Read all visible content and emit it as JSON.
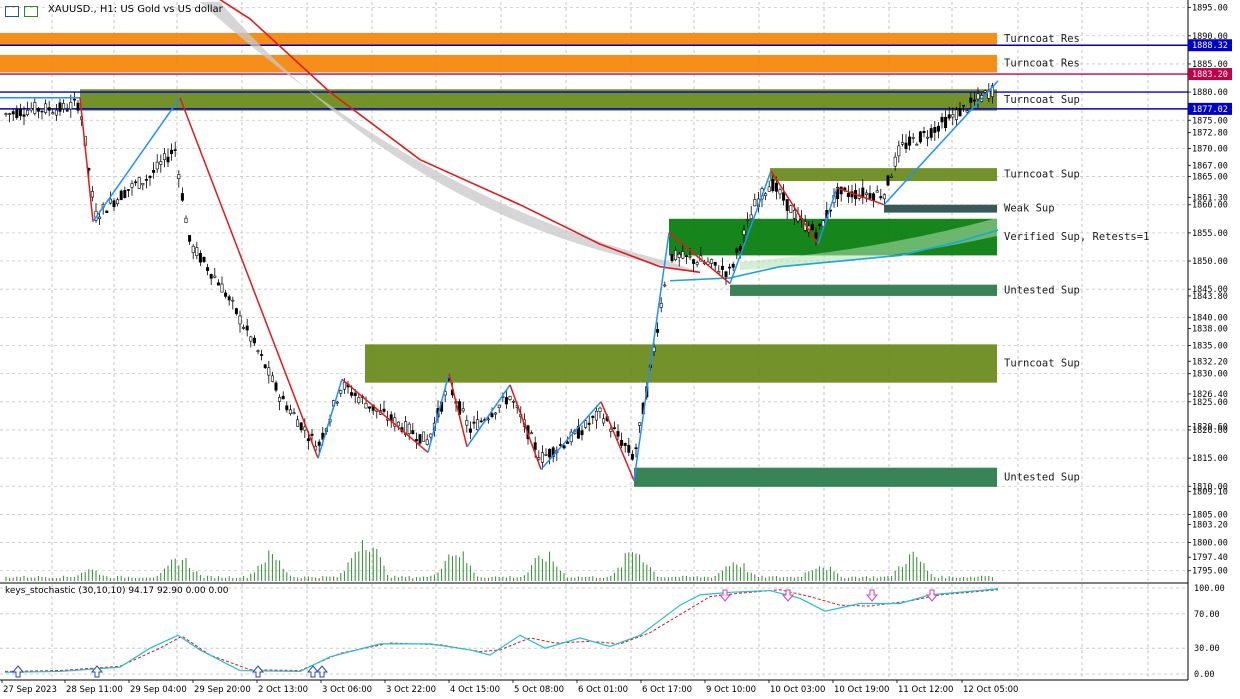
{
  "window": {
    "title": "XAUUSD., H1:  US Gold vs US dollar",
    "icons": [
      "chart-window-icon",
      "symbol-properties-icon"
    ]
  },
  "indicator": {
    "title": "keys_stochastic (30,10,10) 94.17 92.90 0.00 0.00",
    "levels": [
      "100.00",
      "70.00",
      "30.00",
      "0.00"
    ]
  },
  "colors": {
    "orange_zone": "#f4880e",
    "olive_zone": "#6b8c1e",
    "green_zone": "#0a7f10",
    "teal_zone": "#2e7d4d",
    "dark_zone": "#2f4f4f",
    "bear_line": "#e31a1a",
    "bull_line": "#1e90ff",
    "ma_cyan": "#19a9d6",
    "stoch_main": "#1fc1d6",
    "stoch_signal": "#d61a1a",
    "hline_blue": "#0000a0",
    "volume": "#2e8b2e"
  },
  "price_axis": {
    "labels": [
      "1895.00",
      "1890.00",
      "1885.00",
      "1880.00",
      "1875.00",
      "1872.80",
      "1870.00",
      "1867.00",
      "1865.00",
      "1861.30",
      "1860.00",
      "1855.00",
      "1850.00",
      "1845.00",
      "1843.80",
      "1840.00",
      "1838.00",
      "1835.00",
      "1832.20",
      "1830.00",
      "1826.40",
      "1825.00",
      "1820.60",
      "1820.00",
      "1815.00",
      "1810.00",
      "1809.10",
      "1805.00",
      "1803.20",
      "1800.00",
      "1797.40",
      "1795.00"
    ],
    "highlights": [
      {
        "label": "1888.32",
        "color": "#0000c8"
      },
      {
        "label": "1883.20",
        "color": "#c0004a"
      },
      {
        "label": "1877.02",
        "color": "#0000c8"
      }
    ]
  },
  "time_axis": {
    "labels": [
      "27 Sep 2023",
      "28 Sep 11:00",
      "29 Sep 04:00",
      "29 Sep 20:00",
      "2 Oct 13:00",
      "3 Oct 06:00",
      "3 Oct 22:00",
      "4 Oct 15:00",
      "5 Oct 08:00",
      "6 Oct 01:00",
      "6 Oct 17:00",
      "9 Oct 10:00",
      "10 Oct 03:00",
      "10 Oct 19:00",
      "11 Oct 12:00",
      "12 Oct 05:00"
    ]
  },
  "zones": [
    {
      "label": "Turncoat Res"
    },
    {
      "label": "Turncoat Res"
    },
    {
      "label": "Turncoat Sup"
    },
    {
      "label": "Turncoat Sup"
    },
    {
      "label": "Weak Sup"
    },
    {
      "label": "Verified Sup, Retests=1"
    },
    {
      "label": "Untested Sup"
    },
    {
      "label": "Turncoat Sup"
    },
    {
      "label": "Untested Sup"
    }
  ],
  "chart_data": {
    "type": "candlestick",
    "symbol": "XAUUSD.",
    "timeframe": "H1",
    "ylim": [
      1793,
      1896
    ],
    "x_labels": [
      "27 Sep 2023",
      "28 Sep 11:00",
      "29 Sep 04:00",
      "29 Sep 20:00",
      "2 Oct 13:00",
      "3 Oct 06:00",
      "3 Oct 22:00",
      "4 Oct 15:00",
      "5 Oct 08:00",
      "6 Oct 01:00",
      "6 Oct 17:00",
      "9 Oct 10:00",
      "10 Oct 03:00",
      "10 Oct 19:00",
      "11 Oct 12:00",
      "12 Oct 05:00"
    ],
    "zones": [
      {
        "label": "Turncoat Res",
        "type": "resistance",
        "low": 1888.3,
        "high": 1890.5,
        "color": "#f4880e"
      },
      {
        "label": "Turncoat Res",
        "type": "resistance",
        "low": 1883.5,
        "high": 1886.6,
        "color": "#f4880e"
      },
      {
        "label": "Turncoat Sup",
        "type": "support",
        "low": 1876.7,
        "high": 1880.5,
        "color": "#6b8c1e"
      },
      {
        "label": "Turncoat Sup",
        "type": "support",
        "low": 1864.2,
        "high": 1866.5,
        "color": "#6b8c1e"
      },
      {
        "label": "Weak Sup",
        "type": "support",
        "low": 1858.6,
        "high": 1860.0,
        "color": "#2f4f4f"
      },
      {
        "label": "Verified Sup, Retests=1",
        "type": "support",
        "low": 1851.0,
        "high": 1857.5,
        "color": "#0a7f10"
      },
      {
        "label": "Untested Sup",
        "type": "support",
        "low": 1843.8,
        "high": 1845.8,
        "color": "#2e7d4d"
      },
      {
        "label": "Turncoat Sup",
        "type": "support",
        "low": 1828.4,
        "high": 1835.2,
        "color": "#6b8c1e"
      },
      {
        "label": "Untested Sup",
        "type": "support",
        "low": 1809.9,
        "high": 1813.3,
        "color": "#2e7d4d"
      }
    ],
    "horizontal_lines": [
      {
        "price": 1888.32,
        "color": "#0000c8"
      },
      {
        "price": 1883.2,
        "color": "#c0004a"
      },
      {
        "price": 1880.0,
        "color": "#0000c8"
      },
      {
        "price": 1877.02,
        "color": "#0000c8"
      }
    ],
    "zigzag": [
      [
        0,
        1879
      ],
      [
        80,
        1879
      ],
      [
        93,
        1857
      ],
      [
        180,
        1879
      ],
      [
        318,
        1815
      ],
      [
        342,
        1829
      ],
      [
        428,
        1816
      ],
      [
        449,
        1830
      ],
      [
        467,
        1817
      ],
      [
        510,
        1828
      ],
      [
        541,
        1813
      ],
      [
        601,
        1825
      ],
      [
        634,
        1811
      ],
      [
        669,
        1855
      ],
      [
        730,
        1846
      ],
      [
        771,
        1866
      ],
      [
        818,
        1853
      ],
      [
        837,
        1863
      ],
      [
        884,
        1860
      ],
      [
        998,
        1882
      ]
    ],
    "ohlc_path": [
      [
        5,
        1876
      ],
      [
        30,
        1877
      ],
      [
        60,
        1877
      ],
      [
        80,
        1878
      ],
      [
        95,
        1858
      ],
      [
        130,
        1863
      ],
      [
        150,
        1865
      ],
      [
        175,
        1870
      ],
      [
        190,
        1853
      ],
      [
        220,
        1846
      ],
      [
        255,
        1835
      ],
      [
        280,
        1826
      ],
      [
        318,
        1817
      ],
      [
        342,
        1828
      ],
      [
        380,
        1823
      ],
      [
        428,
        1818
      ],
      [
        449,
        1828
      ],
      [
        470,
        1820
      ],
      [
        510,
        1826
      ],
      [
        541,
        1815
      ],
      [
        575,
        1819
      ],
      [
        601,
        1823
      ],
      [
        634,
        1815
      ],
      [
        650,
        1830
      ],
      [
        669,
        1851
      ],
      [
        700,
        1850
      ],
      [
        730,
        1848
      ],
      [
        755,
        1860
      ],
      [
        771,
        1864
      ],
      [
        800,
        1857
      ],
      [
        818,
        1855
      ],
      [
        837,
        1862
      ],
      [
        884,
        1862
      ],
      [
        900,
        1870
      ],
      [
        930,
        1873
      ],
      [
        998,
        1881
      ]
    ],
    "moving_average_red": [
      [
        180,
        1901
      ],
      [
        250,
        1893
      ],
      [
        330,
        1880
      ],
      [
        420,
        1868
      ],
      [
        520,
        1860
      ],
      [
        600,
        1853
      ],
      [
        660,
        1849
      ],
      [
        700,
        1848
      ]
    ],
    "moving_average_cyan": [
      [
        670,
        1846.5
      ],
      [
        730,
        1847
      ],
      [
        780,
        1849
      ],
      [
        840,
        1850
      ],
      [
        900,
        1851
      ],
      [
        960,
        1853.5
      ],
      [
        998,
        1855.5
      ]
    ],
    "volume": [
      [
        90,
        4
      ],
      [
        180,
        8
      ],
      [
        270,
        9
      ],
      [
        365,
        16
      ],
      [
        455,
        11
      ],
      [
        545,
        9
      ],
      [
        635,
        11
      ],
      [
        735,
        7
      ],
      [
        820,
        6
      ],
      [
        912,
        9
      ],
      [
        985,
        2
      ]
    ],
    "stochastic": {
      "main": [
        [
          5,
          2
        ],
        [
          60,
          3
        ],
        [
          120,
          8
        ],
        [
          150,
          30
        ],
        [
          178,
          45
        ],
        [
          200,
          28
        ],
        [
          240,
          4
        ],
        [
          300,
          3
        ],
        [
          330,
          20
        ],
        [
          380,
          35
        ],
        [
          430,
          35
        ],
        [
          470,
          28
        ],
        [
          490,
          22
        ],
        [
          520,
          45
        ],
        [
          545,
          30
        ],
        [
          580,
          42
        ],
        [
          610,
          32
        ],
        [
          640,
          45
        ],
        [
          680,
          80
        ],
        [
          700,
          92
        ],
        [
          730,
          95
        ],
        [
          770,
          97
        ],
        [
          800,
          88
        ],
        [
          825,
          73
        ],
        [
          860,
          82
        ],
        [
          900,
          82
        ],
        [
          930,
          92
        ],
        [
          998,
          99
        ]
      ],
      "signal": [
        [
          5,
          3
        ],
        [
          60,
          4
        ],
        [
          120,
          9
        ],
        [
          160,
          30
        ],
        [
          182,
          44
        ],
        [
          210,
          22
        ],
        [
          250,
          5
        ],
        [
          300,
          4
        ],
        [
          340,
          24
        ],
        [
          390,
          36
        ],
        [
          440,
          34
        ],
        [
          480,
          26
        ],
        [
          500,
          28
        ],
        [
          530,
          42
        ],
        [
          555,
          36
        ],
        [
          590,
          38
        ],
        [
          620,
          35
        ],
        [
          650,
          48
        ],
        [
          690,
          76
        ],
        [
          710,
          90
        ],
        [
          740,
          94
        ],
        [
          780,
          98
        ],
        [
          810,
          90
        ],
        [
          840,
          80
        ],
        [
          870,
          79
        ],
        [
          910,
          85
        ],
        [
          940,
          92
        ],
        [
          998,
          98
        ]
      ],
      "up_arrows": [
        18,
        97,
        258,
        313,
        322
      ],
      "down_arrows": [
        725,
        788,
        872,
        932
      ]
    }
  }
}
